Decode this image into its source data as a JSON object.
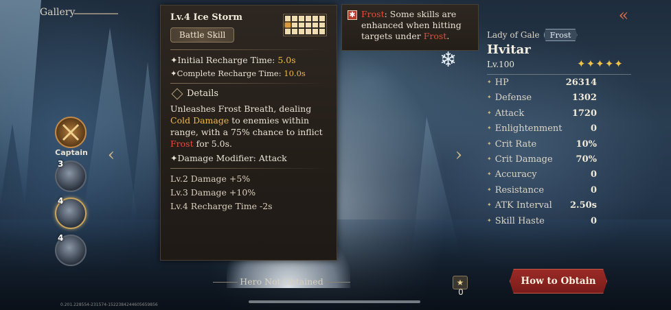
{
  "gallery": {
    "title": "Gallery"
  },
  "characters": [
    {
      "label": "Captain",
      "count": ""
    },
    {
      "label": "",
      "count": "3"
    },
    {
      "label": "",
      "count": "4"
    },
    {
      "label": "",
      "count": "4"
    }
  ],
  "skill": {
    "name": "Lv.4 Ice Storm",
    "type": "Battle Skill",
    "initial_label": "Initial Recharge Time: ",
    "initial_value": "5.0s",
    "complete_label": "Complete Recharge Time: ",
    "complete_value": "10.0s",
    "details_title": "Details",
    "desc_part1": "Unleashes Frost Breath, dealing ",
    "desc_cold": "Cold Damage",
    "desc_part2": " to enemies within range, with a 75% chance to inflict ",
    "desc_frost": "Frost",
    "desc_part3": " for 5.0s.",
    "modifier": "Damage Modifier: Attack",
    "levels": [
      "Lv.2 Damage +5%",
      "Lv.3 Damage +10%",
      "Lv.4 Recharge Time -2s"
    ]
  },
  "frost_tip": {
    "badge": "✱",
    "word": "Frost",
    "text1": ": Some skills are enhanced when hitting targets under ",
    "word2": "Frost",
    "text2": "."
  },
  "hero": {
    "subtitle": "Lady of Gale",
    "element": "Frost",
    "name": "Hvitar",
    "level": "Lv.100",
    "stars": "✦✦✦✦✦",
    "stats": [
      {
        "key": "HP",
        "value": "26314"
      },
      {
        "key": "Defense",
        "value": "1302"
      },
      {
        "key": "Attack",
        "value": "1720"
      },
      {
        "key": "Enlightenment",
        "value": "0"
      },
      {
        "key": "Crit Rate",
        "value": "10%"
      },
      {
        "key": "Crit Damage",
        "value": "70%"
      },
      {
        "key": "Accuracy",
        "value": "0"
      },
      {
        "key": "Resistance",
        "value": "0"
      },
      {
        "key": "ATK Interval",
        "value": "2.50s"
      },
      {
        "key": "Skill Haste",
        "value": "0"
      }
    ]
  },
  "footer": {
    "not_obtained": "Hero Not Obtained",
    "star_count": "0",
    "obtain_button": "How to Obtain",
    "coords": "0.201.228554-231574-1522384244605659856"
  },
  "colors": {
    "accent_gold": "#f0b84a",
    "frost_red": "#e0503c",
    "button_red": "#9a2a26"
  }
}
